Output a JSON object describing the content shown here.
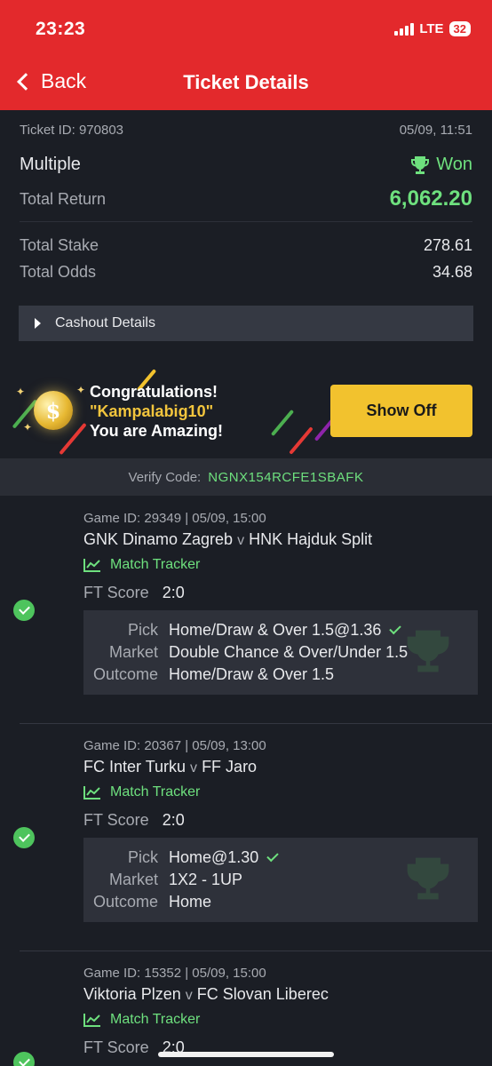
{
  "status": {
    "time": "23:23",
    "network": "LTE",
    "battery": "32"
  },
  "nav": {
    "back_label": "Back",
    "title": "Ticket Details"
  },
  "ticket": {
    "id_label": "Ticket ID: 970803",
    "datetime": "05/09, 11:51",
    "type": "Multiple",
    "status": "Won",
    "total_return_label": "Total Return",
    "total_return": "6,062.20",
    "total_stake_label": "Total Stake",
    "total_stake": "278.61",
    "total_odds_label": "Total Odds",
    "total_odds": "34.68",
    "cashout_label": "Cashout Details"
  },
  "congrats": {
    "line1": "Congratulations!",
    "username": "\"Kampalabig10\"",
    "line3": "You are Amazing!",
    "button": "Show Off"
  },
  "verify": {
    "label": "Verify Code:",
    "code": "NGNX154RCFE1SBAFK"
  },
  "labels": {
    "tracker": "Match Tracker",
    "ft_score": "FT Score",
    "pick": "Pick",
    "market": "Market",
    "outcome": "Outcome",
    "v": "v"
  },
  "games": [
    {
      "id_line": "Game ID: 29349 | 05/09, 15:00",
      "home": "GNK Dinamo Zagreb",
      "away": "HNK Hajduk Split",
      "score": "2:0",
      "pick": "Home/Draw & Over 1.5@1.36",
      "market": "Double Chance & Over/Under 1.5",
      "outcome": "Home/Draw & Over 1.5"
    },
    {
      "id_line": "Game ID: 20367 | 05/09, 13:00",
      "home": "FC Inter Turku",
      "away": "FF Jaro",
      "score": "2:0",
      "pick": "Home@1.30",
      "market": "1X2 - 1UP",
      "outcome": "Home"
    },
    {
      "id_line": "Game ID: 15352 | 05/09, 15:00",
      "home": "Viktoria Plzen",
      "away": "FC Slovan Liberec",
      "score": "2:0"
    }
  ],
  "colors": {
    "header": "#e3292c",
    "accent_green": "#6ee07e",
    "show_off": "#f2c22e"
  }
}
